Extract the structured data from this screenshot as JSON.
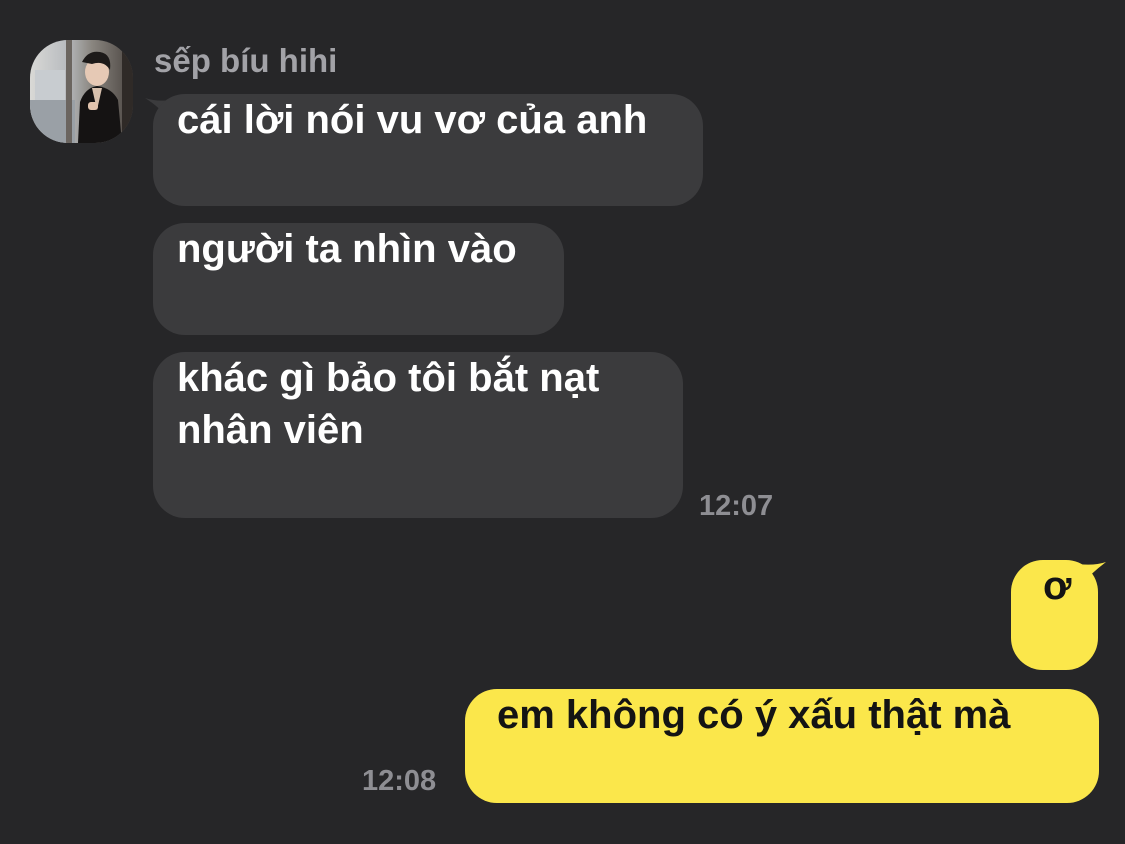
{
  "conversation": {
    "sender_name": "sếp bíu hihi",
    "avatar_icon": "profile-photo-man-in-dark-suit",
    "incoming_color": "#3b3b3d",
    "outgoing_color": "#fbe74b",
    "background_color": "#262628"
  },
  "messages": {
    "incoming": [
      {
        "text": "cái lời nói vu vơ của anh"
      },
      {
        "text": "người ta nhìn vào"
      },
      {
        "text": "khác gì bảo tôi bắt nạt nhân viên"
      }
    ],
    "incoming_time": "12:07",
    "outgoing": [
      {
        "text": "ơ"
      },
      {
        "text": "em không có ý xấu thật mà"
      }
    ],
    "outgoing_time": "12:08"
  }
}
